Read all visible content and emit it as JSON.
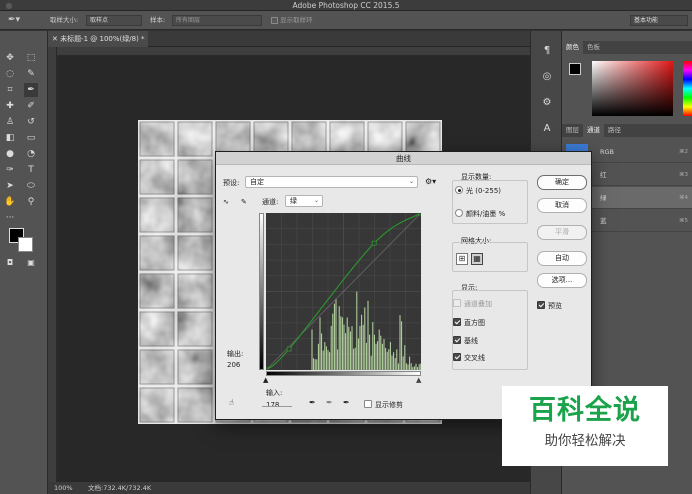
{
  "app": {
    "title": "Adobe Photoshop CC 2015.5"
  },
  "options_bar": {
    "sample_size_label": "取样大小:",
    "sample_size_value": "取样点",
    "sample_label": "样本:",
    "sample_value": "所有图层",
    "show_ring_label": "显示取样环",
    "workspace_value": "基本功能"
  },
  "document": {
    "tab_label": "未标题-1 @ 100%(绿/8) *"
  },
  "status": {
    "zoom": "100%",
    "doc_size": "文档:732.4K/732.4K"
  },
  "curves_dialog": {
    "title": "曲线",
    "preset_label": "预设:",
    "preset_value": "自定",
    "channel_label": "通道:",
    "channel_value": "绿",
    "output_label": "输出:",
    "output_value": "206",
    "input_label": "输入:",
    "input_value": "178",
    "show_clipping_label": "显示修剪",
    "show_amount_title": "显示数量:",
    "light_option": "光 (0-255)",
    "pigment_option": "颜料/油墨 %",
    "grid_size_title": "网格大小:",
    "show_title": "显示:",
    "channel_overlays": "通道叠加",
    "histogram": "直方图",
    "baseline": "基线",
    "intersection_line": "交叉线",
    "buttons": {
      "ok": "确定",
      "cancel": "取消",
      "smooth": "平滑",
      "auto": "自动",
      "options": "选项..."
    },
    "preview_label": "预览",
    "curve_points": [
      [
        0,
        0
      ],
      [
        38,
        34
      ],
      [
        178,
        206
      ],
      [
        255,
        255
      ]
    ],
    "histogram_color": "#c8ecb0",
    "curve_color": "#2a9a2a"
  },
  "right_panel": {
    "color_tabs": [
      "颜色",
      "色板"
    ],
    "channel_tabs": [
      "图层",
      "通道",
      "路径"
    ],
    "channels": [
      {
        "name": "RGB",
        "shortcut": "⌘2"
      },
      {
        "name": "红",
        "shortcut": "⌘3"
      },
      {
        "name": "绿",
        "shortcut": "⌘4"
      },
      {
        "name": "蓝",
        "shortcut": "⌘5"
      }
    ]
  },
  "watermark": {
    "line1": "百科全说",
    "line2": "助你轻松解决"
  },
  "colors": {
    "accent": "#1aa34a",
    "dialog_bg": "#e8e8e8",
    "ui_bg": "#535353"
  }
}
